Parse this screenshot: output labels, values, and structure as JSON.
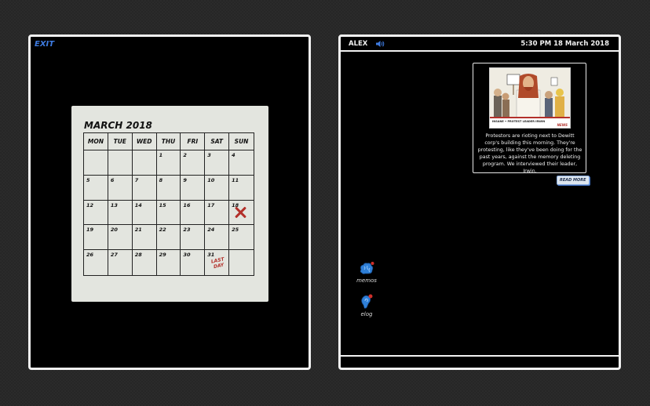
{
  "left_panel": {
    "exit_label": "EXIT",
    "calendar": {
      "title": "MARCH 2018",
      "weekdays": [
        "MON",
        "TUE",
        "WED",
        "THU",
        "FRI",
        "SAT",
        "SUN"
      ],
      "weeks": [
        [
          "",
          "",
          "",
          "1",
          "2",
          "3",
          "4"
        ],
        [
          "5",
          "6",
          "7",
          "8",
          "9",
          "10",
          "11"
        ],
        [
          "12",
          "13",
          "14",
          "15",
          "16",
          "17",
          "18"
        ],
        [
          "19",
          "20",
          "21",
          "22",
          "23",
          "24",
          "25"
        ],
        [
          "26",
          "27",
          "28",
          "29",
          "30",
          "31",
          ""
        ]
      ],
      "marked_day": "18",
      "mark_color": "#b3302a",
      "last_day_note": "LAST DAY",
      "last_day_date": "31"
    }
  },
  "right_panel": {
    "user_name": "ALEX",
    "sound_icon": "speaker-icon",
    "datetime": "5:30 PM 18 March 2018",
    "news": {
      "image_caption": "INSANE • PROTEST LEADER IRWIN",
      "image_logo": "NEWS",
      "text": "Protestors are rioting next to Dewitt corp's building this morning. They're protesting, like they've been doing for the past years, against the memory deleting program. We interviewed their leader, Irwin.",
      "read_more_label": "READ MORE"
    },
    "apps": [
      {
        "label": "memos",
        "icon": "brain-icon",
        "badge_color": "#d0302a"
      },
      {
        "label": "elog",
        "icon": "ear-icon",
        "badge_color": "#d0302a"
      }
    ]
  },
  "colors": {
    "accent": "#3e7be0",
    "panel_border": "#f2f2f2",
    "calendar_bg": "#e3e5df"
  }
}
